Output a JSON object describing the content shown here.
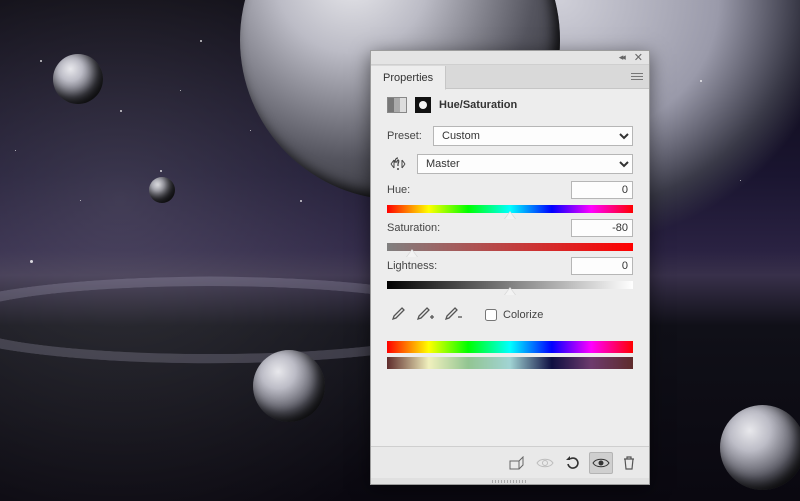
{
  "panel": {
    "tab_label": "Properties",
    "adjustment_title": "Hue/Saturation",
    "preset_label": "Preset:",
    "preset_value": "Custom",
    "channel_value": "Master",
    "sliders": {
      "hue": {
        "label": "Hue:",
        "value": "0",
        "pos_pct": 50
      },
      "saturation": {
        "label": "Saturation:",
        "value": "-80",
        "pos_pct": 10
      },
      "lightness": {
        "label": "Lightness:",
        "value": "0",
        "pos_pct": 50
      }
    },
    "colorize_label": "Colorize",
    "colorize_checked": false
  }
}
